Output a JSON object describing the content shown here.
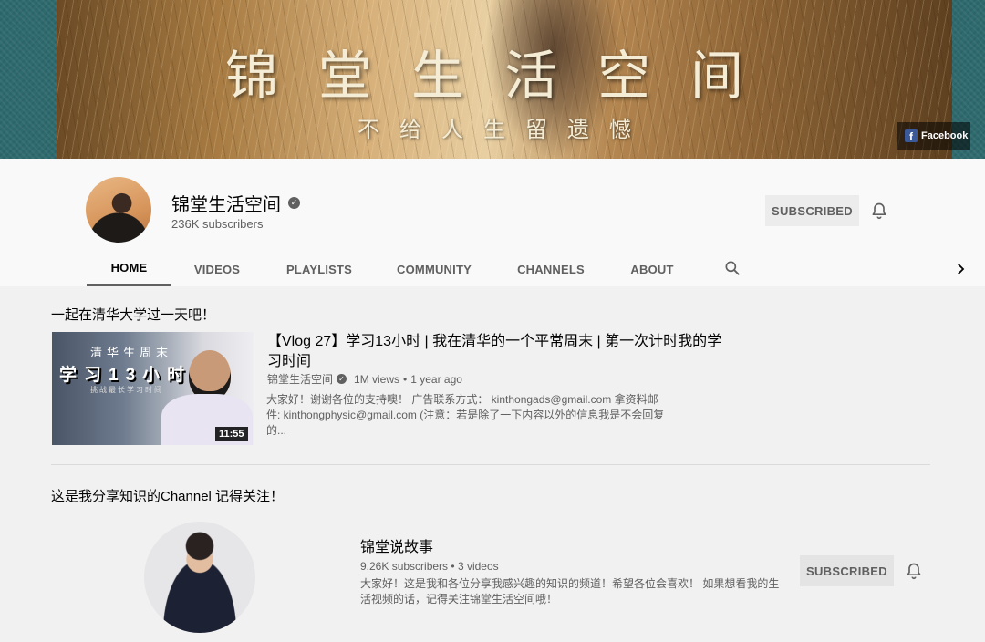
{
  "banner": {
    "title": "锦堂生活空间",
    "subtitle": "不给人生留遗憾",
    "link_label": "Facebook"
  },
  "channel": {
    "name": "锦堂生活空间",
    "subscribers": "236K subscribers",
    "subscribe_label": "SUBSCRIBED"
  },
  "tabs": [
    {
      "label": "HOME",
      "active": true
    },
    {
      "label": "VIDEOS"
    },
    {
      "label": "PLAYLISTS"
    },
    {
      "label": "COMMUNITY"
    },
    {
      "label": "CHANNELS"
    },
    {
      "label": "ABOUT"
    }
  ],
  "sections": [
    {
      "title": "一起在清华大学过一天吧！",
      "video": {
        "thumb_text1": "清华生周末",
        "thumb_text2": "学习13小时",
        "thumb_text3": "挑战最长学习时间",
        "duration": "11:55",
        "title": "【Vlog 27】学习13小时 | 我在清华的一个平常周末 | 第一次计时我的学习时间",
        "channel": "锦堂生活空间",
        "views": "1M views",
        "age": "1 year ago",
        "description": "大家好！谢谢各位的支持噢！ 广告联系方式： kinthongads@gmail.com 拿资料邮件: kinthongphysic@gmail.com (注意：若是除了一下内容以外的信息我是不会回复的..."
      }
    },
    {
      "title": "这是我分享知识的Channel 记得关注！",
      "featured_channel": {
        "name": "锦堂说故事",
        "subscribers": "9.26K subscribers",
        "videos": "3 videos",
        "description": "大家好！这是我和各位分享我感兴趣的知识的频道！希望各位会喜欢！ 如果想看我的生活视频的话，记得关注锦堂生活空间哦！",
        "subscribe_label": "SUBSCRIBED"
      }
    }
  ],
  "colors": {
    "accent_text": "#030303",
    "secondary_text": "#606060",
    "subscribed_bg": "#ececec"
  }
}
